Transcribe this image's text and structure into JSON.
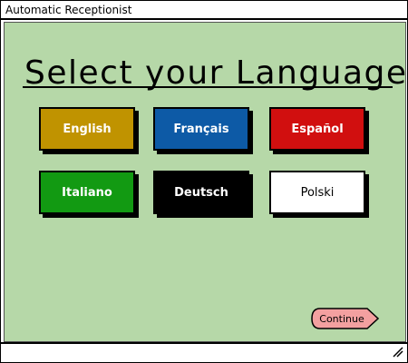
{
  "window": {
    "title": "Automatic Receptionist"
  },
  "heading": "Select your Language",
  "languages": [
    {
      "label": "English",
      "color": "#c09300"
    },
    {
      "label": "Français",
      "color": "#0d5aa6"
    },
    {
      "label": "Español",
      "color": "#d10f0f"
    },
    {
      "label": "Italiano",
      "color": "#129a12"
    },
    {
      "label": "Deutsch",
      "color": "#000000"
    },
    {
      "label": "Polski",
      "color": "#ffffff"
    }
  ],
  "continue_button": {
    "label": "Continue",
    "color": "#f3a0a0"
  },
  "colors": {
    "background": "#b6d8a8"
  },
  "icons": {
    "resize": "resize-grip-icon"
  }
}
